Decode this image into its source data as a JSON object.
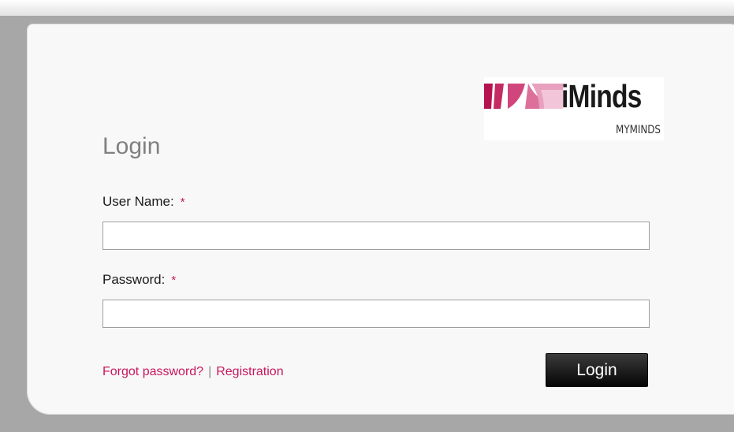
{
  "brand": {
    "name": "iMinds",
    "sub": "MYMINDS",
    "colors": [
      "#b5134f",
      "#c9306e",
      "#dd6f9b",
      "#efb7cd"
    ]
  },
  "form": {
    "title": "Login",
    "username_label": "User Name:",
    "password_label": "Password:",
    "required_mark": "*",
    "username_value": "",
    "password_value": "",
    "forgot_label": "Forgot password?",
    "separator": "|",
    "register_label": "Registration",
    "login_button": "Login"
  },
  "colors": {
    "accent": "#c6175e",
    "page_bg": "#a7a7a7",
    "panel_bg": "#f8f8f8",
    "button_bg": "#111111"
  }
}
